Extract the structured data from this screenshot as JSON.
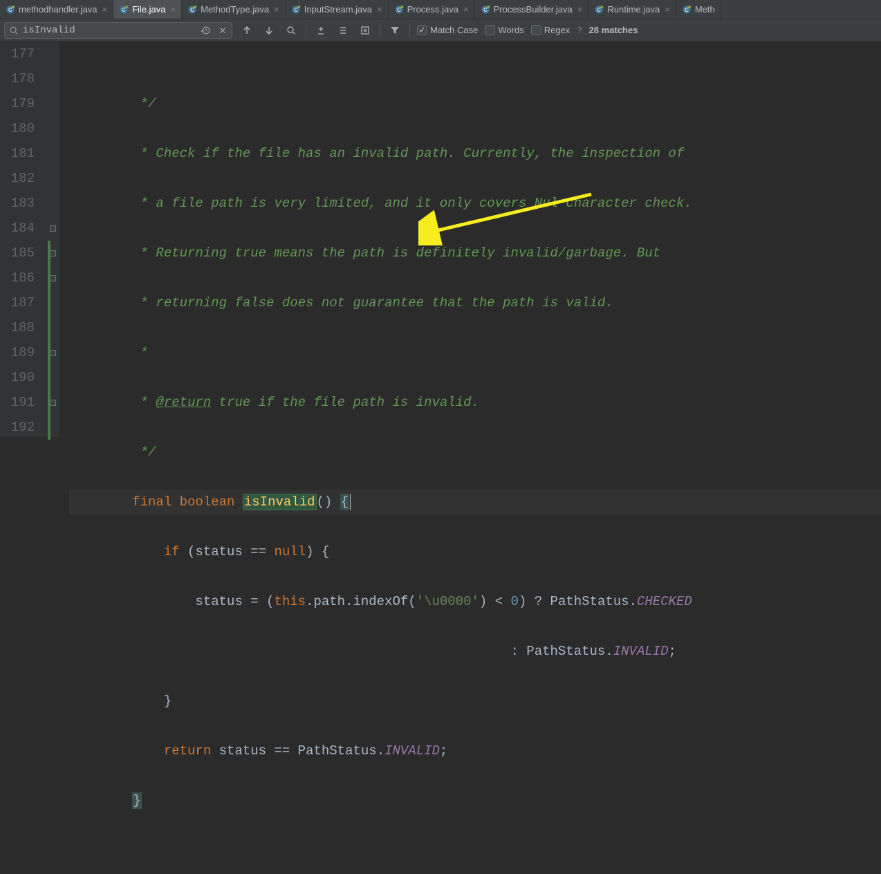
{
  "tabs": [
    {
      "label": "methodhandler.java",
      "active": false,
      "iconColor": "#4aa0d8"
    },
    {
      "label": "File.java",
      "active": true,
      "iconColor": "#4aa0d8"
    },
    {
      "label": "MethodType.java",
      "active": false,
      "iconColor": "#4aa0d8"
    },
    {
      "label": "InputStream.java",
      "active": false,
      "iconColor": "#4aa0d8"
    },
    {
      "label": "Process.java",
      "active": false,
      "iconColor": "#4aa0d8"
    },
    {
      "label": "ProcessBuilder.java",
      "active": false,
      "iconColor": "#4aa0d8"
    },
    {
      "label": "Runtime.java",
      "active": false,
      "iconColor": "#4aa0d8"
    },
    {
      "label": "Meth",
      "active": false,
      "iconColor": "#4aa0d8",
      "truncated": true
    }
  ],
  "find": {
    "query": "isInvalid",
    "matchCase": {
      "label": "Match Case",
      "checked": true
    },
    "words": {
      "label": "Words",
      "checked": false
    },
    "regex": {
      "label": "Regex",
      "checked": false
    },
    "matches": "28 matches"
  },
  "lineNumbers": [
    "177",
    "178",
    "179",
    "180",
    "181",
    "182",
    "183",
    "184",
    "185",
    "186",
    "187",
    "188",
    "189",
    "190",
    "191",
    "192"
  ],
  "code": {
    "l177": "         */",
    "l178_a": "         * Check if the file has an invalid path. Currently, the inspection of",
    "l179_a": "         * a file path is very limited, and it only covers Nul character check.",
    "l180_a": "         * Returning true means the path is definitely invalid/garbage. But",
    "l181_a": "         * returning false does not guarantee that the path is valid.",
    "l182_a": "         *",
    "l183_prefix": "         * ",
    "l183_tag": "@return",
    "l183_rest": " true if the file path is invalid.",
    "l184_a": "         */",
    "l185_kw1": "final",
    "l185_kw2": "boolean",
    "l185_method": "isInvalid",
    "l185_rest1": "() ",
    "l185_rest2": "{",
    "l186_pre": "            ",
    "l186_kw": "if",
    "l186_rest": " (status == ",
    "l186_null": "null",
    "l186_rest2": ") {",
    "l187_pre": "                status = (",
    "l187_this": "this",
    "l187_rest1": ".path.indexOf(",
    "l187_str": "'\\u0000'",
    "l187_rest2": ") < ",
    "l187_num": "0",
    "l187_rest3": ") ? PathStatus.",
    "l187_const": "CHECKED",
    "l188_pre": "                                                        : PathStatus.",
    "l188_const": "INVALID",
    "l188_semi": ";",
    "l189_a": "            }",
    "l190_pre": "            ",
    "l190_kw": "return",
    "l190_rest": " status == PathStatus.",
    "l190_const": "INVALID",
    "l190_semi": ";",
    "l191_a": "        ",
    "l191_b": "}"
  }
}
